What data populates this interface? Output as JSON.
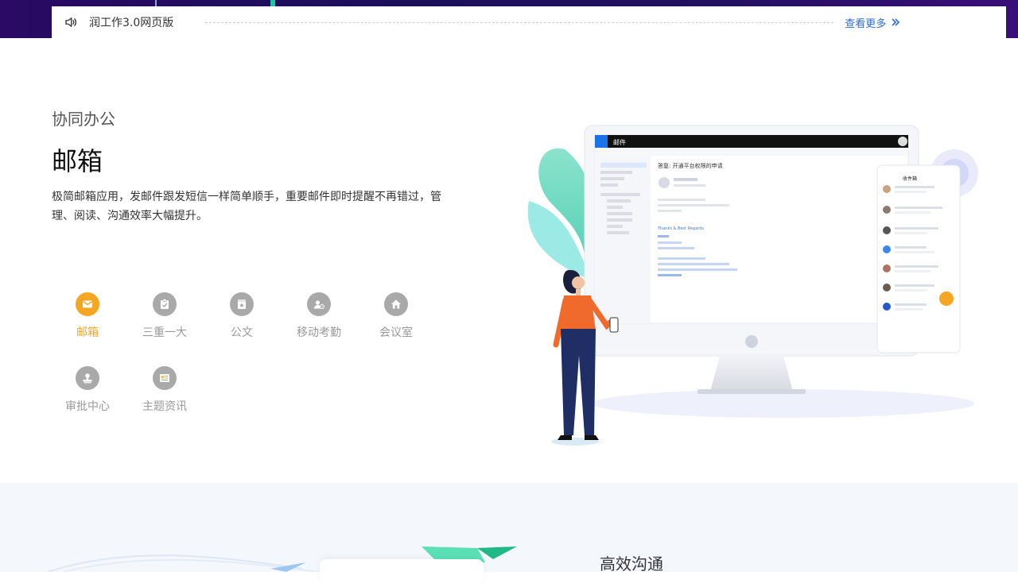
{
  "notice": {
    "title": "润工作3.0网页版",
    "more_label": "查看更多"
  },
  "section": {
    "kicker": "协同办公",
    "heading": "邮箱",
    "description": "极简邮箱应用，发邮件跟发短信一样简单顺手，重要邮件即时提醒不再错过，管理、阅读、沟通效率大幅提升。"
  },
  "features": [
    {
      "label": "邮箱",
      "icon": "mail-icon",
      "active": true
    },
    {
      "label": "三重一大",
      "icon": "clipboard-check-icon",
      "active": false
    },
    {
      "label": "公文",
      "icon": "document-star-icon",
      "active": false
    },
    {
      "label": "移动考勤",
      "icon": "attendance-icon",
      "active": false
    },
    {
      "label": "会议室",
      "icon": "home-icon",
      "active": false
    },
    {
      "label": "审批中心",
      "icon": "approval-stamp-icon",
      "active": false
    },
    {
      "label": "主题资讯",
      "icon": "news-icon",
      "active": false
    }
  ],
  "illustration": {
    "app_title": "邮件",
    "mail_subject": "答复: 开通平台权限的申请",
    "mobile_title": "收件箱",
    "signature": "Thanks & Best Regards"
  },
  "bottom": {
    "heading": "高效沟通"
  },
  "colors": {
    "active": "#f5a623",
    "inactive_icon": "#a9a9a9",
    "link": "#2f6bd0"
  }
}
